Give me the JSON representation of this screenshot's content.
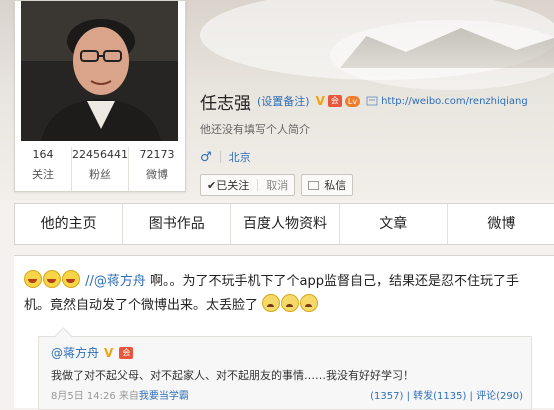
{
  "profile": {
    "name": "任志强",
    "remark_link": "(设置备注)",
    "url": "http://weibo.com/renzhiqiang",
    "bio": "他还没有填写个人简介",
    "gender_icon": "male-icon",
    "city": "北京",
    "follow_status": "已关注",
    "cancel_label": "取消",
    "message_label": "私信"
  },
  "stats": [
    {
      "value": "164",
      "label": "关注"
    },
    {
      "value": "22456441",
      "label": "粉丝"
    },
    {
      "value": "72173",
      "label": "微博"
    }
  ],
  "nav": {
    "tabs": [
      "他的主页",
      "图书作品",
      "百度人物资料",
      "文章",
      "微博"
    ]
  },
  "post": {
    "mention": "//@蒋方舟",
    "text_part1": "啊。。为了不玩手机下了个app监督自己，结果还是忍不住玩了手",
    "text_part2": "机。竟然自动发了个微博出来。太丢脸了"
  },
  "repost": {
    "author": "@蒋方舟",
    "text": "我做了对不起父母、对不起家人、对不起朋友的事情……我没有好好学习！",
    "date": "8月5日 14:26",
    "source_prefix": "来自",
    "source": "我要当学霸",
    "counts": "(1357) | 转发(1135) | 评论(290)"
  },
  "colors": {
    "link": "#2e6fb7",
    "vip": "#e8573b",
    "verified": "#f0a30a"
  }
}
